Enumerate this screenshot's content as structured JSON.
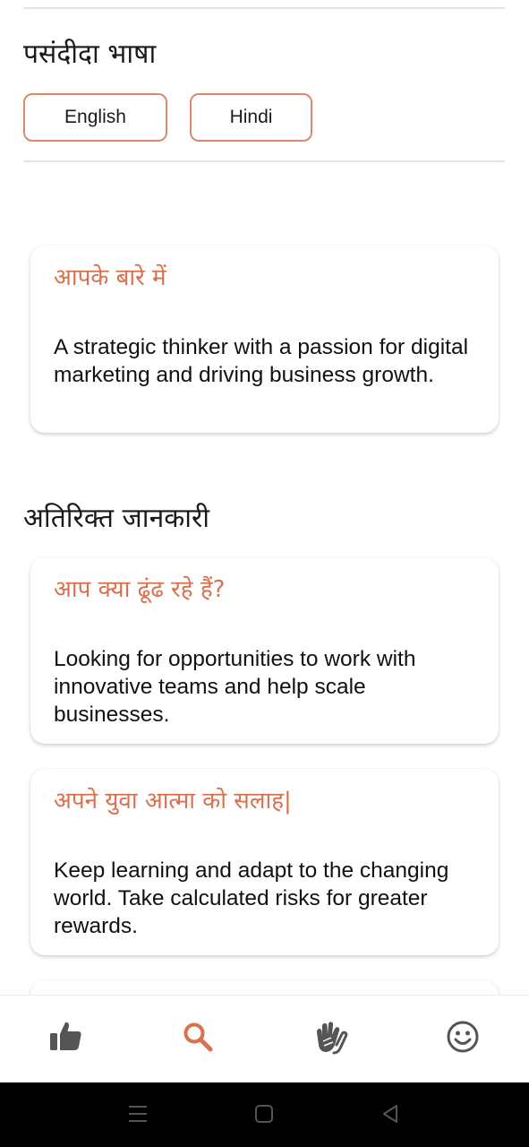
{
  "language_section": {
    "title": "पसंदीदा भाषा",
    "options": [
      "English",
      "Hindi"
    ]
  },
  "about_card": {
    "title": "आपके बारे में",
    "body": "A strategic thinker with a passion for digital marketing and driving business growth."
  },
  "extra_section": {
    "title": "अतिरिक्त जानकारी"
  },
  "cards": [
    {
      "title": "आप क्या ढूंढ रहे हैं?",
      "body": "Looking for opportunities to work with innovative teams and help scale businesses."
    },
    {
      "title": "अपने युवा आत्मा को सलाह|",
      "body": "Keep learning and adapt to the changing world. Take calculated risks for greater rewards."
    }
  ],
  "bottom_nav": {
    "items": [
      "thumbs-up-icon",
      "search-icon",
      "waving-hands-icon",
      "smiley-icon"
    ],
    "active": "search-icon",
    "active_color": "#d9714e",
    "inactive_color": "#555555"
  },
  "colors": {
    "accent": "#d9714e",
    "button_border": "#d98a6c"
  }
}
